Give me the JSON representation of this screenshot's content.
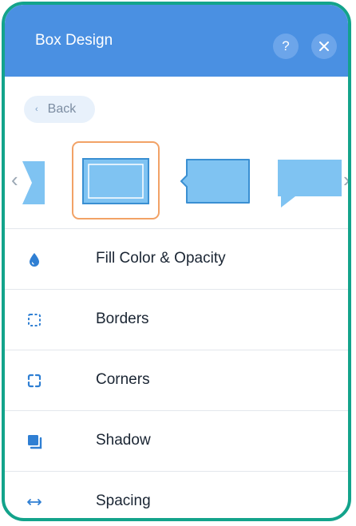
{
  "header": {
    "title": "Box Design",
    "help_label": "?",
    "close_icon": "close-icon"
  },
  "back": {
    "label": "Back",
    "icon": "chevron-left-icon"
  },
  "carousel": {
    "prev_icon": "chevron-left-icon",
    "next_icon": "chevron-right-icon",
    "presets": [
      {
        "name": "partial-preset"
      },
      {
        "name": "inset-frame-box",
        "selected": true
      },
      {
        "name": "side-arrow-box"
      },
      {
        "name": "speech-bubble-box"
      }
    ]
  },
  "menu": {
    "items": [
      {
        "label": "Fill Color & Opacity",
        "icon": "droplet-icon"
      },
      {
        "label": "Borders",
        "icon": "dashed-square-icon"
      },
      {
        "label": "Corners",
        "icon": "corners-icon"
      },
      {
        "label": "Shadow",
        "icon": "shadow-square-icon"
      },
      {
        "label": "Spacing",
        "icon": "horizontal-arrows-icon"
      }
    ]
  },
  "colors": {
    "frame": "#13a38b",
    "header": "#4a90e2",
    "accent": "#4a90e2",
    "shape_fill": "#7fc3f2",
    "selected_border": "#f2a266"
  }
}
